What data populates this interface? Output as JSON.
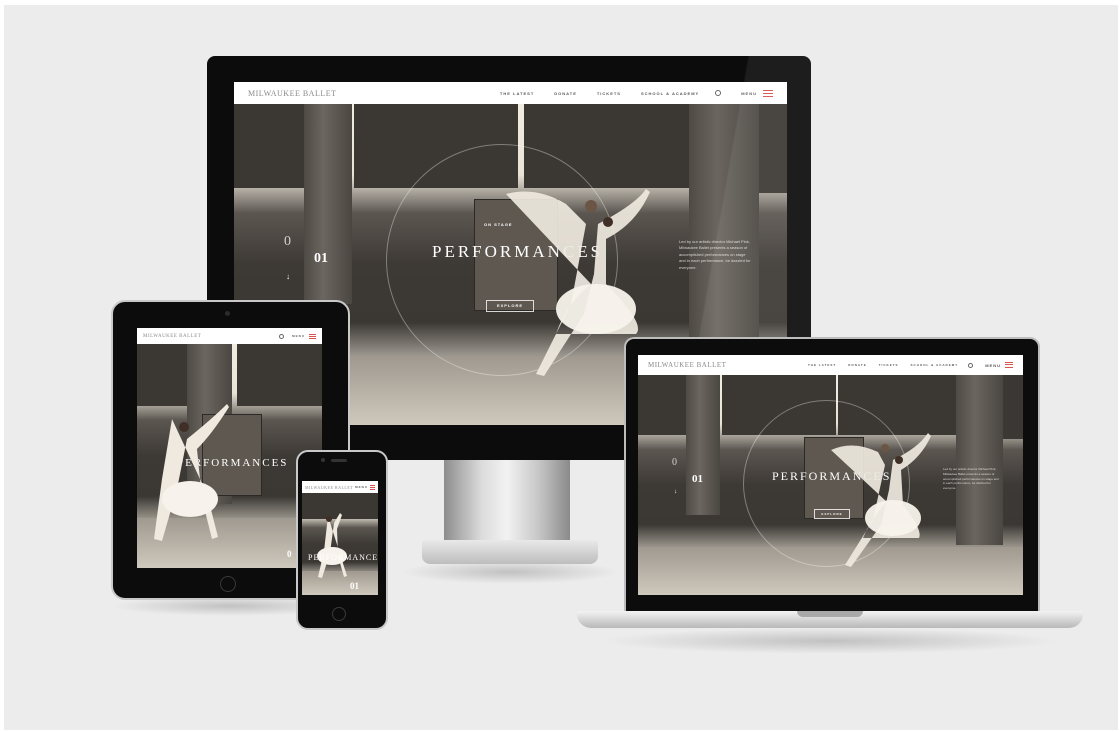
{
  "site": {
    "brand": "MILWAUKEE BALLET",
    "nav_links": [
      "THE LATEST",
      "DONATE",
      "TICKETS",
      "SCHOOL & ACADEMY"
    ],
    "menu_label": "MENU",
    "hero": {
      "eyebrow": "ON STAGE",
      "title": "PERFORMANCES",
      "number": "01",
      "zero": "0",
      "explore_label": "EXPLORE",
      "arrow": "↓",
      "blurb": "Led by our artistic director Michael Pink, Milwaukee Ballet presents a season of accomplished performances on stage and in each performance, be dazzled for everyone."
    }
  },
  "tablet": {
    "title": "PERFORMANCES",
    "number": "0"
  },
  "phone": {
    "title": "PERFORMANCES",
    "number": "01"
  },
  "colors": {
    "menu_accent": "#d9534f",
    "backdrop": "#ececec"
  }
}
